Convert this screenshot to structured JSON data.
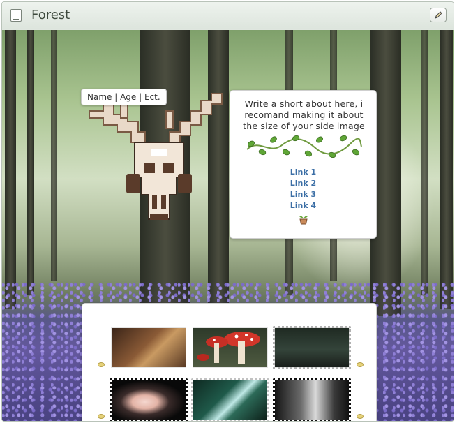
{
  "window": {
    "title": "Forest",
    "title_icon": "notes-icon",
    "edit_icon": "pencil-icon"
  },
  "profile": {
    "name_tag": "Name | Age | Ect."
  },
  "about": {
    "text": "Write a short about here, i recomand making it about the size of your side image",
    "links": [
      "Link 1",
      "Link 2",
      "Link 3",
      "Link 4"
    ]
  },
  "colors": {
    "link": "#3b6ea5",
    "card_bg": "#ffffff",
    "titlebar": "#dde5dd"
  }
}
